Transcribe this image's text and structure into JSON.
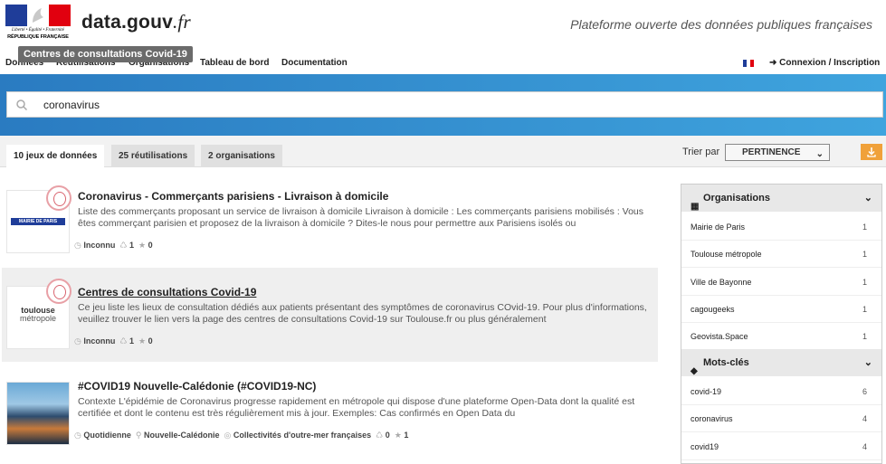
{
  "header": {
    "gov_motto": "Liberté • Égalité • Fraternité",
    "gov_name": "RÉPUBLIQUE FRANÇAISE",
    "brand_main": "data.gouv",
    "brand_tld": ".fr",
    "tagline": "Plateforme ouverte des données publiques françaises",
    "tooltip": "Centres de consultations Covid-19"
  },
  "nav": {
    "items": [
      "Données",
      "Réutilisations",
      "Organisations",
      "Tableau de bord",
      "Documentation"
    ],
    "login": "Connexion / Inscription"
  },
  "search": {
    "value": "coronavirus",
    "placeholder": "Rechercher"
  },
  "tabs": [
    {
      "label": "10 jeux de données",
      "active": true
    },
    {
      "label": "25 réutilisations",
      "active": false
    },
    {
      "label": "2 organisations",
      "active": false
    }
  ],
  "sort": {
    "label": "Trier par",
    "value": "PERTINENCE"
  },
  "results": [
    {
      "title": "Coronavirus - Commerçants parisiens - Livraison à domicile",
      "desc": "Liste des commerçants proposant un service de livraison à domicile Livraison à domicile : Les commerçants parisiens mobilisés : Vous êtes commerçant parisien et proposez de la livraison à domicile ? Dites-le nous pour permettre aux Parisiens isolés ou",
      "logo": "MAIRIE DE PARIS",
      "frequency": "Inconnu",
      "reuses": "1",
      "stars": "0"
    },
    {
      "title": "Centres de consultations Covid-19",
      "desc": "Ce jeu liste les lieux de consultation dédiés aux patients présentant des symptômes de coronavirus COvid-19. Pour plus d'informations, veuillez trouver le lien vers la page des centres de consultations Covid-19 sur Toulouse.fr ou plus généralement",
      "logo_line1": "toulouse",
      "logo_line2": "métropole",
      "frequency": "Inconnu",
      "reuses": "1",
      "stars": "0"
    },
    {
      "title": "#COVID19 Nouvelle-Calédonie (#COVID19-NC)",
      "desc": "Contexte L'épidémie de Coronavirus progresse rapidement en métropole qui dispose d'une plateforme Open-Data dont la qualité est certifiée et dont le contenu est très régulièrement mis à jour. Exemples: Cas confirmés en Open Data du",
      "frequency": "Quotidienne",
      "location": "Nouvelle-Calédonie",
      "scope": "Collectivités d'outre-mer françaises",
      "reuses": "0",
      "stars": "1"
    }
  ],
  "sidebar": {
    "orgs_title": "Organisations",
    "orgs": [
      {
        "name": "Mairie de Paris",
        "count": "1"
      },
      {
        "name": "Toulouse métropole",
        "count": "1"
      },
      {
        "name": "Ville de Bayonne",
        "count": "1"
      },
      {
        "name": "cagougeeks",
        "count": "1"
      },
      {
        "name": "Geovista.Space",
        "count": "1"
      }
    ],
    "tags_title": "Mots-clés",
    "tags": [
      {
        "name": "covid-19",
        "count": "6"
      },
      {
        "name": "coronavirus",
        "count": "4"
      },
      {
        "name": "covid19",
        "count": "4"
      }
    ]
  },
  "colors": {
    "banner": "#2a7bc1",
    "accent": "#f0a13a",
    "blue_fr": "#1f3d99",
    "red_fr": "#e1000f"
  }
}
